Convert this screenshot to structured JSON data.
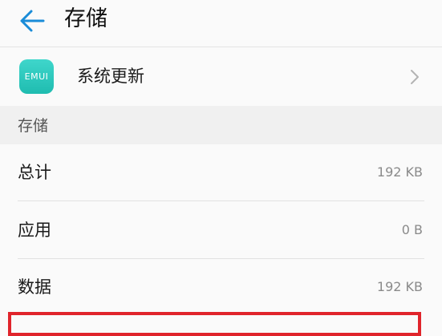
{
  "header": {
    "back_icon": "arrow-left-icon",
    "title": "存储"
  },
  "app": {
    "icon_text": "EMUI",
    "icon_color": "#2ac9bd",
    "name": "系统更新",
    "chevron_icon": "chevron-right-icon"
  },
  "storage": {
    "section_title": "存储",
    "rows": [
      {
        "label": "总计",
        "value": "192 KB"
      },
      {
        "label": "应用",
        "value": "0 B"
      },
      {
        "label": "数据",
        "value": "192 KB"
      }
    ]
  },
  "colors": {
    "accent": "#1a8cd8",
    "highlight": "#e0242b"
  }
}
